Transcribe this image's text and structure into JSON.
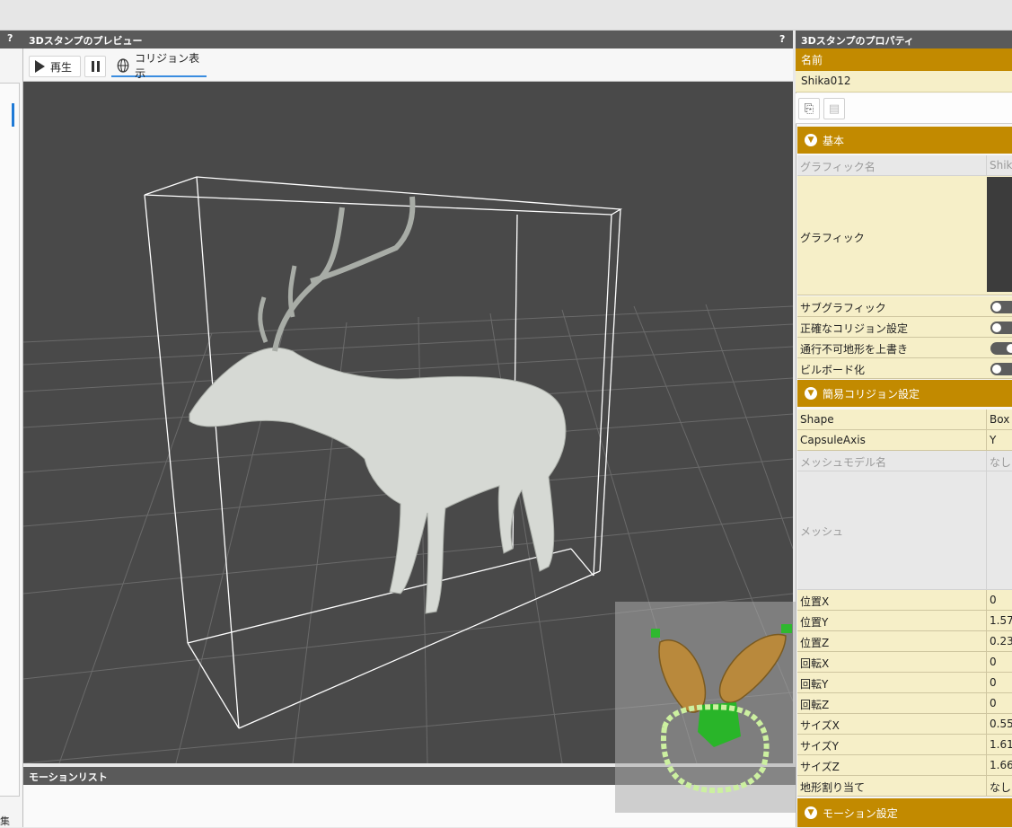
{
  "preview": {
    "title": "3Dスタンプのプレビュー",
    "help": "?",
    "play_label": "再生",
    "collision_label": "コリジョン表示"
  },
  "left": {
    "help": "?",
    "bottom_text": "集"
  },
  "motion_list": {
    "title": "モーションリスト"
  },
  "properties": {
    "title": "3Dスタンプのプロパティ",
    "help": "?",
    "name_label": "名前",
    "name_value": "Shika012",
    "sections": {
      "basic": "基本",
      "simple_collision": "簡易コリジョン設定",
      "motion": "モーション設定"
    },
    "basic_rows": [
      {
        "label": "グラフィック名",
        "value": "Shik"
      },
      {
        "label": "グラフィック"
      },
      {
        "label": "サブグラフィック",
        "toggle": false
      },
      {
        "label": "正確なコリジョン設定",
        "toggle": false
      },
      {
        "label": "通行不可地形を上書き",
        "toggle": true
      },
      {
        "label": "ビルボード化",
        "toggle": false
      }
    ],
    "collision_rows": [
      {
        "label": "Shape",
        "value": "Box"
      },
      {
        "label": "CapsuleAxis",
        "value": "Y"
      },
      {
        "label": "メッシュモデル名",
        "value": "なし"
      },
      {
        "label": "メッシュ"
      },
      {
        "label": "位置X",
        "value": "0"
      },
      {
        "label": "位置Y",
        "value": "1.57"
      },
      {
        "label": "位置Z",
        "value": "0.23"
      },
      {
        "label": "回転X",
        "value": "0"
      },
      {
        "label": "回転Y",
        "value": "0"
      },
      {
        "label": "回転Z",
        "value": "0"
      },
      {
        "label": "サイズX",
        "value": "0.55"
      },
      {
        "label": "サイズY",
        "value": "1.61"
      },
      {
        "label": "サイズZ",
        "value": "1.66"
      },
      {
        "label": "地形割り当て",
        "value": "なし"
      }
    ]
  },
  "colors": {
    "section": "#c28a00",
    "row_bg": "#f6efc8",
    "viewport_bg": "#494949",
    "panel_header": "#5a5a5a",
    "accent_blue": "#3a8de0"
  }
}
